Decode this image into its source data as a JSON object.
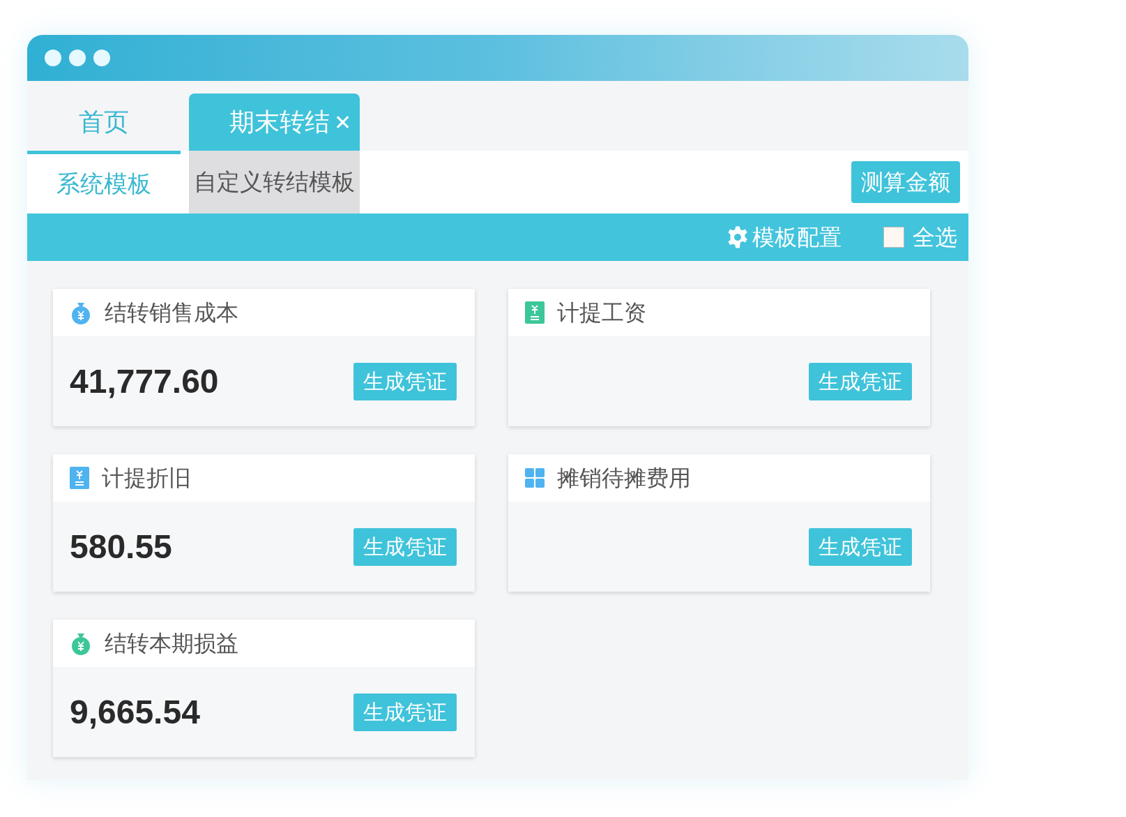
{
  "tabs": [
    {
      "label": "首页",
      "selected": false
    },
    {
      "label": "期末转结",
      "selected": true,
      "close": "✕"
    }
  ],
  "sub_tabs": [
    {
      "label": "系统模板",
      "selected": true
    },
    {
      "label": "自定义转结模板",
      "selected": false
    }
  ],
  "calc_button": "测算金额",
  "toolbar": {
    "config": "模板配置",
    "select_all": {
      "label": "全选",
      "checked": false
    }
  },
  "cards": [
    {
      "title": "结转销售成本",
      "kind": "bag",
      "color": "#4fb3f0",
      "amount": "41,777.60",
      "button": "生成凭证"
    },
    {
      "title": "计提工资",
      "kind": "doc",
      "color": "#3cc79a",
      "button": "生成凭证"
    },
    {
      "title": "计提折旧",
      "kind": "doc",
      "color": "#4fb3f0",
      "amount": "580.55",
      "button": "生成凭证"
    },
    {
      "title": "摊销待摊费用",
      "kind": "grid",
      "color": "#4fb3f0",
      "button": "生成凭证"
    },
    {
      "title": "结转本期损益",
      "kind": "bag",
      "color": "#3cc79a",
      "amount": "9,665.54",
      "button": "生成凭证"
    }
  ]
}
